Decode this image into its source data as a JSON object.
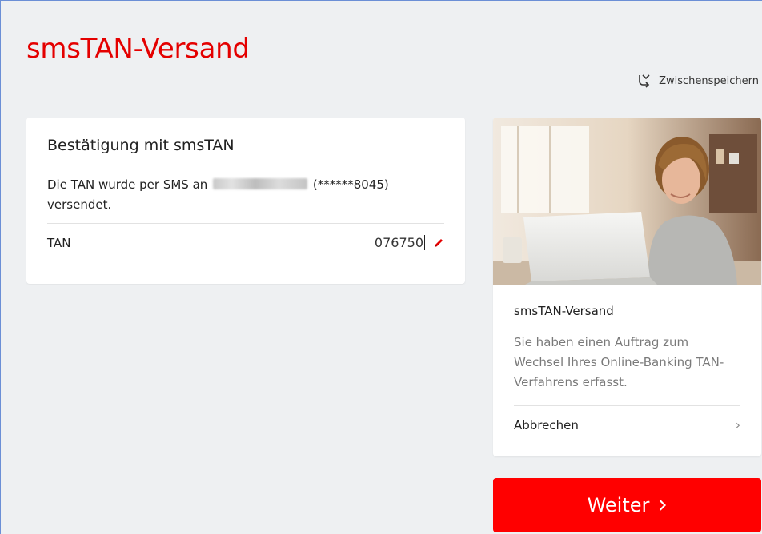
{
  "page": {
    "title": "smsTAN-Versand"
  },
  "toolbar": {
    "save_label": "Zwischenspeichern"
  },
  "confirm_card": {
    "title": "Bestätigung mit smsTAN",
    "sms_prefix": "Die TAN wurde per SMS an",
    "phone_masked": "(******8045)",
    "sms_suffix": "versendet.",
    "tan_label": "TAN",
    "tan_value": "076750"
  },
  "info_card": {
    "title": "smsTAN-Versand",
    "text": "Sie haben einen Auftrag zum Wechsel Ihres Online-Banking TAN-Verfahrens erfasst.",
    "cancel_label": "Abbrechen",
    "cancel_icon": "chevron-right-icon"
  },
  "actions": {
    "next_label": "Weiter",
    "next_icon": "chevron-right-icon"
  },
  "colors": {
    "brand": "#ff0000",
    "title_red": "#e40000",
    "background": "#eef0f2"
  }
}
